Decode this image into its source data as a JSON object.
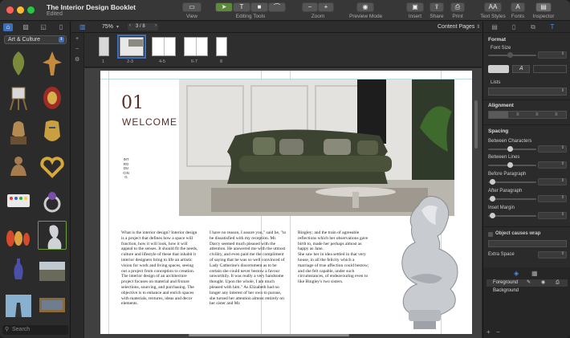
{
  "window": {
    "title": "The Interior Design Booklet",
    "subtitle": "Edited",
    "traffic_lights": {
      "close": "#ff5f57",
      "minimize": "#febc2e",
      "zoom": "#28c840"
    }
  },
  "toolbar": {
    "view_label": "View",
    "editing_tools_label": "Editing Tools",
    "zoom_label": "Zoom",
    "preview_mode_label": "Preview Mode",
    "insert_label": "Insert",
    "share_label": "Share",
    "print_label": "Print",
    "text_styles_label": "Text Styles",
    "fonts_label": "Fonts",
    "inspector_label": "Inspector",
    "text_styles_button_text": "AA",
    "fonts_button_text": "A"
  },
  "subbar": {
    "zoom_value": "75%",
    "page_indicator": "3 / 8",
    "view_mode": "Content Pages"
  },
  "left_panel": {
    "category": "Art & Culture",
    "search_placeholder": "Search",
    "thumbnails": [
      "leaf-art-icon",
      "dancer-figurine-icon",
      "easel-icon",
      "decorated-egg-icon",
      "pharaoh-bust-icon",
      "golden-mask-icon",
      "buddha-statue-icon",
      "golden-heart-icon",
      "paint-palette-icon",
      "ring-jewel-icon",
      "matryoshka-dolls-icon",
      "marble-bust-icon",
      "blue-vase-icon",
      "landscape-painting-icon",
      "statue-sky-icon",
      "framed-landscape-icon"
    ]
  },
  "pages": [
    {
      "label": "1"
    },
    {
      "label": "2-3"
    },
    {
      "label": "4-5"
    },
    {
      "label": "6-7"
    },
    {
      "label": "8"
    }
  ],
  "document": {
    "number": "01",
    "heading": "WELCOME",
    "vertical_label": "INTRODUCING",
    "col1": "What is the interior design? Interior design is a project that defines how a space will function, how it will look, how it will appeal to the senses. It should fit the needs, culture and lifestyle of these that inhabit it interior designers bring to life an artistic vision for work and living spaces, seeing out a project from conception to creation.\nThe interior design of an architecture project focuses on material and fixture selections, sourcing, and purchasing. The objective is to enhance and enrich spaces with materials, textures, ideas and decor elements.",
    "col2": "I have no reason, I assure you,\" said he, \"to be dissatisfied with my reception. Mr. Darcy seemed much pleased with the attention. He answered me with the utmost civility, and even paid me the compliment of saying that he was so well convinced of Lady Catherine's discernment as to be certain she could never bestow a favour unworthily. It was really a very handsome thought. Upon the whole, I am much pleased with him.\" As Elizabeth had no longer any interest of her own to pursue, she turned her attention almost entirely on her sister and Mr.",
    "col3": "Bingley; and the train of agreeable reflections which her observations gave birth to, made her perhaps almost as happy as Jane.\nShe saw her in idea settled in that very house, in all the felicity which a marriage of true affection could bestow; and she felt capable, under such circumstances, of endeavouring even to like Bingley's two sisters."
  },
  "inspector": {
    "format_heading": "Format",
    "font_size_label": "Font Size",
    "lists_label": "Lists",
    "alignment_heading": "Alignment",
    "spacing_heading": "Spacing",
    "between_characters_label": "Between Characters",
    "between_lines_label": "Between Lines",
    "before_paragraph_label": "Before Paragraph",
    "after_paragraph_label": "After Paragraph",
    "inset_margin_label": "Inset Margin",
    "object_causes_wrap_label": "Object causes wrap",
    "extra_space_label": "Extra Space",
    "layers": [
      {
        "name": "Foreground"
      },
      {
        "name": "Background"
      }
    ]
  },
  "colors": {
    "accent": "#3f6fb8",
    "heading": "#5a2e28"
  }
}
